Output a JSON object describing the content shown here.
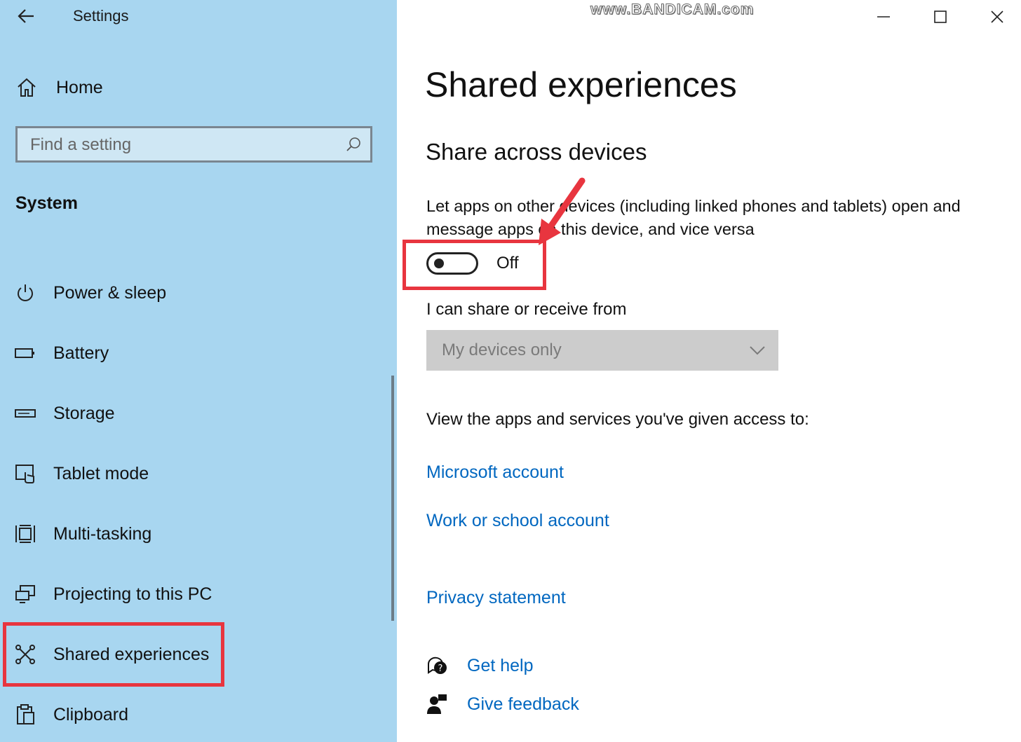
{
  "window": {
    "app_title": "Settings",
    "watermark": "www.BANDICAM.com"
  },
  "sidebar": {
    "home_label": "Home",
    "search": {
      "placeholder": "Find a setting"
    },
    "section_label": "System",
    "items": [
      {
        "label": "Power & sleep",
        "icon": "power-icon"
      },
      {
        "label": "Battery",
        "icon": "battery-icon"
      },
      {
        "label": "Storage",
        "icon": "storage-icon"
      },
      {
        "label": "Tablet mode",
        "icon": "tablet-mode-icon"
      },
      {
        "label": "Multi-tasking",
        "icon": "multitasking-icon"
      },
      {
        "label": "Projecting to this PC",
        "icon": "projecting-icon"
      },
      {
        "label": "Shared experiences",
        "icon": "shared-experiences-icon",
        "selected": true
      },
      {
        "label": "Clipboard",
        "icon": "clipboard-icon"
      }
    ]
  },
  "main": {
    "title": "Shared experiences",
    "subheading": "Share across devices",
    "description": "Let apps on other devices (including linked phones and tablets) open and message apps on this device, and vice versa",
    "toggle": {
      "state": "Off",
      "on": false
    },
    "share_label": "I can share or receive from",
    "dropdown": {
      "value": "My devices only",
      "disabled": true
    },
    "view_label": "View the apps and services you've given access to:",
    "links": {
      "microsoft_account": "Microsoft account",
      "work_school_account": "Work or school account",
      "privacy_statement": "Privacy statement"
    },
    "help": {
      "get_help": "Get help",
      "give_feedback": "Give feedback"
    }
  },
  "colors": {
    "sidebar_bg": "#a8d6f0",
    "link": "#0067c0",
    "highlight": "#e8353f",
    "dropdown_bg": "#cccccc"
  }
}
